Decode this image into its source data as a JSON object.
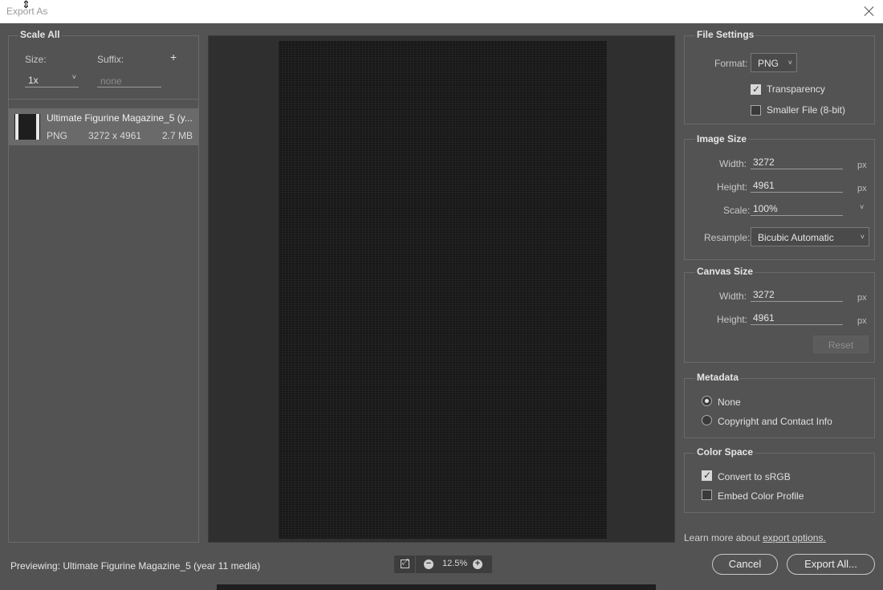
{
  "window": {
    "title": "Export As"
  },
  "scale_all": {
    "title": "Scale All",
    "size_label": "Size:",
    "suffix_label": "Suffix:",
    "add_label": "+",
    "size_value": "1x",
    "suffix_placeholder": "none"
  },
  "asset": {
    "name": "Ultimate Figurine Magazine_5 (y...",
    "format": "PNG",
    "dimensions": "3272 x 4961",
    "filesize": "2.7 MB"
  },
  "file_settings": {
    "title": "File Settings",
    "format_label": "Format:",
    "format_value": "PNG",
    "transparency_label": "Transparency",
    "transparency_checked": true,
    "smaller_file_label": "Smaller File (8-bit)",
    "smaller_file_checked": false
  },
  "image_size": {
    "title": "Image Size",
    "width_label": "Width:",
    "width_value": "3272",
    "height_label": "Height:",
    "height_value": "4961",
    "scale_label": "Scale:",
    "scale_value": "100%",
    "resample_label": "Resample:",
    "resample_value": "Bicubic Automatic",
    "unit": "px"
  },
  "canvas_size": {
    "title": "Canvas Size",
    "width_label": "Width:",
    "width_value": "3272",
    "height_label": "Height:",
    "height_value": "4961",
    "unit": "px",
    "reset_label": "Reset"
  },
  "metadata": {
    "title": "Metadata",
    "options": [
      "None",
      "Copyright and Contact Info"
    ],
    "selected": "None"
  },
  "color_space": {
    "title": "Color Space",
    "convert_label": "Convert to sRGB",
    "convert_checked": true,
    "embed_label": "Embed Color Profile",
    "embed_checked": false
  },
  "footer": {
    "learn_more_text": "Learn more about ",
    "learn_more_link": "export options.",
    "previewing": "Previewing: Ultimate Figurine Magazine_5 (year 11 media)",
    "zoom_value": "12.5%",
    "cancel_label": "Cancel",
    "export_label": "Export All..."
  }
}
